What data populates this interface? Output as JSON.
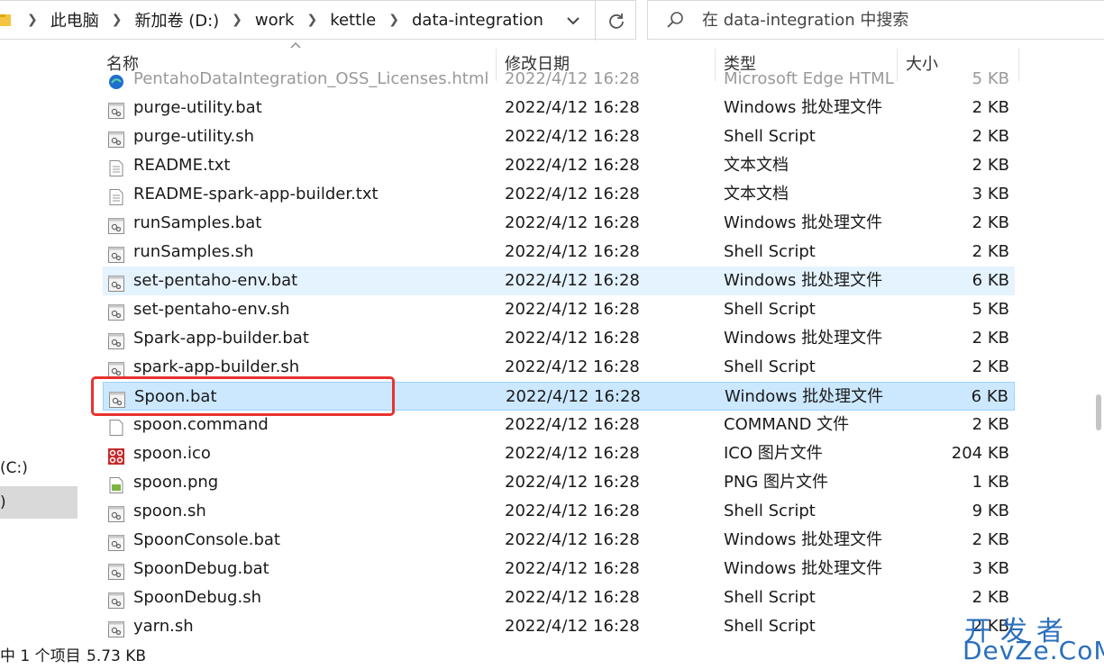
{
  "address_bar": {
    "breadcrumbs": [
      "此电脑",
      "新加卷 (D:)",
      "work",
      "kettle",
      "data-integration"
    ]
  },
  "search": {
    "placeholder": "在 data-integration 中搜索"
  },
  "nav": {
    "drive_c": "(C:)",
    "selected": ")"
  },
  "columns": {
    "name": "名称",
    "date": "修改日期",
    "type": "类型",
    "size": "大小"
  },
  "files": [
    {
      "name": "PentahoDataIntegration_OSS_Licenses.html",
      "date": "2022/4/12 16:28",
      "type": "Microsoft Edge HTML",
      "size": "5 KB",
      "icon": "edge-html-icon"
    },
    {
      "name": "purge-utility.bat",
      "date": "2022/4/12 16:28",
      "type": "Windows 批处理文件",
      "size": "2 KB",
      "icon": "batch-file-icon"
    },
    {
      "name": "purge-utility.sh",
      "date": "2022/4/12 16:28",
      "type": "Shell Script",
      "size": "2 KB",
      "icon": "script-file-icon"
    },
    {
      "name": "README.txt",
      "date": "2022/4/12 16:28",
      "type": "文本文档",
      "size": "2 KB",
      "icon": "text-file-icon"
    },
    {
      "name": "README-spark-app-builder.txt",
      "date": "2022/4/12 16:28",
      "type": "文本文档",
      "size": "3 KB",
      "icon": "text-file-icon"
    },
    {
      "name": "runSamples.bat",
      "date": "2022/4/12 16:28",
      "type": "Windows 批处理文件",
      "size": "2 KB",
      "icon": "batch-file-icon"
    },
    {
      "name": "runSamples.sh",
      "date": "2022/4/12 16:28",
      "type": "Shell Script",
      "size": "2 KB",
      "icon": "script-file-icon"
    },
    {
      "name": "set-pentaho-env.bat",
      "date": "2022/4/12 16:28",
      "type": "Windows 批处理文件",
      "size": "6 KB",
      "icon": "batch-file-icon"
    },
    {
      "name": "set-pentaho-env.sh",
      "date": "2022/4/12 16:28",
      "type": "Shell Script",
      "size": "5 KB",
      "icon": "script-file-icon"
    },
    {
      "name": "Spark-app-builder.bat",
      "date": "2022/4/12 16:28",
      "type": "Windows 批处理文件",
      "size": "2 KB",
      "icon": "batch-file-icon"
    },
    {
      "name": "spark-app-builder.sh",
      "date": "2022/4/12 16:28",
      "type": "Shell Script",
      "size": "2 KB",
      "icon": "script-file-icon"
    },
    {
      "name": "Spoon.bat",
      "date": "2022/4/12 16:28",
      "type": "Windows 批处理文件",
      "size": "6 KB",
      "icon": "batch-file-icon"
    },
    {
      "name": "spoon.command",
      "date": "2022/4/12 16:28",
      "type": "COMMAND 文件",
      "size": "2 KB",
      "icon": "blank-file-icon"
    },
    {
      "name": "spoon.ico",
      "date": "2022/4/12 16:28",
      "type": "ICO 图片文件",
      "size": "204 KB",
      "icon": "spoon-ico-icon"
    },
    {
      "name": "spoon.png",
      "date": "2022/4/12 16:28",
      "type": "PNG 图片文件",
      "size": "1 KB",
      "icon": "png-file-icon"
    },
    {
      "name": "spoon.sh",
      "date": "2022/4/12 16:28",
      "type": "Shell Script",
      "size": "9 KB",
      "icon": "script-file-icon"
    },
    {
      "name": "SpoonConsole.bat",
      "date": "2022/4/12 16:28",
      "type": "Windows 批处理文件",
      "size": "2 KB",
      "icon": "batch-file-icon"
    },
    {
      "name": "SpoonDebug.bat",
      "date": "2022/4/12 16:28",
      "type": "Windows 批处理文件",
      "size": "3 KB",
      "icon": "batch-file-icon"
    },
    {
      "name": "SpoonDebug.sh",
      "date": "2022/4/12 16:28",
      "type": "Shell Script",
      "size": "2 KB",
      "icon": "script-file-icon"
    },
    {
      "name": "yarn.sh",
      "date": "2022/4/12 16:28",
      "type": "Shell Script",
      "size": "2 KB",
      "icon": "script-file-icon"
    }
  ],
  "hovered_index": 7,
  "selected_index": 11,
  "status": {
    "selection": "中 1 个项目",
    "size": "5.73 KB"
  },
  "watermark": {
    "line1": "开发者",
    "line2": "DevZe.CoM"
  },
  "colors": {
    "selected_bg": "#cce8ff",
    "hover_bg": "#e5f3ff",
    "highlight_border": "#e8322f"
  }
}
